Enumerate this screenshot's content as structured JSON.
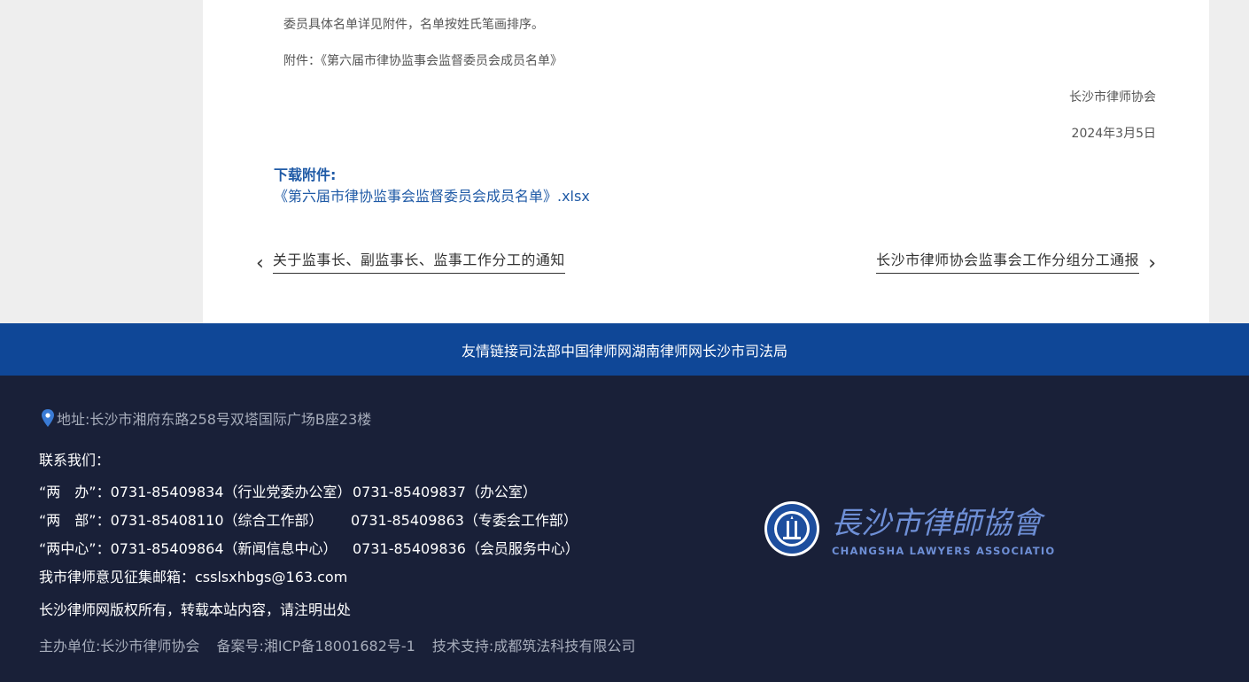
{
  "article": {
    "para1": "委员具体名单详见附件，名单按姓氏笔画排序。",
    "para2": "附件：《第六届市律协监事会监督委员会成员名单》",
    "signature": "长沙市律师协会",
    "date": "2024年3月5日"
  },
  "download": {
    "title": "下载附件:",
    "file": "《第六届市律协监事会监督委员会成员名单》.xlsx"
  },
  "nav": {
    "prev": "关于监事长、副监事长、监事工作分工的通知",
    "next": "长沙市律师协会监事会工作分组分工通报"
  },
  "links": {
    "label": "友情链接",
    "items": [
      "司法部",
      "中国律师网",
      "湖南律师网",
      "长沙市司法局"
    ]
  },
  "footer": {
    "address": "地址:长沙市湘府东路258号双塔国际广场B座23楼",
    "contact_title": "联系我们：",
    "rows": [
      {
        "left": "“两　办”：0731-85409834（行业党委办公室）",
        "right": "0731-85409837（办公室）"
      },
      {
        "left": "“两　部”：0731-85408110（综合工作部）",
        "right": "0731-85409863（专委会工作部）"
      },
      {
        "left": "“两中心”：0731-85409864（新闻信息中心）",
        "right": "0731-85409836（会员服务中心）"
      }
    ],
    "email": "我市律师意见征集邮箱：csslsxhbgs@163.com",
    "copyright": "长沙律师网版权所有，转载本站内容，请注明出处",
    "host": "主办单位:长沙市律师协会",
    "icp": "备案号:湘ICP备18001682号-1",
    "tech": "技术支持:成都筑法科技有限公司"
  },
  "logo": {
    "cn": "長沙市律師協會",
    "en": "CHANGSHA LAWYERS ASSOCIATION",
    "seal_text": "长沙市律师协会"
  },
  "colors": {
    "link_bar": "#0f4797",
    "footer_bg": "#192038",
    "link_blue": "#1f5aa6",
    "logo_blue": "#6e8fd6"
  }
}
